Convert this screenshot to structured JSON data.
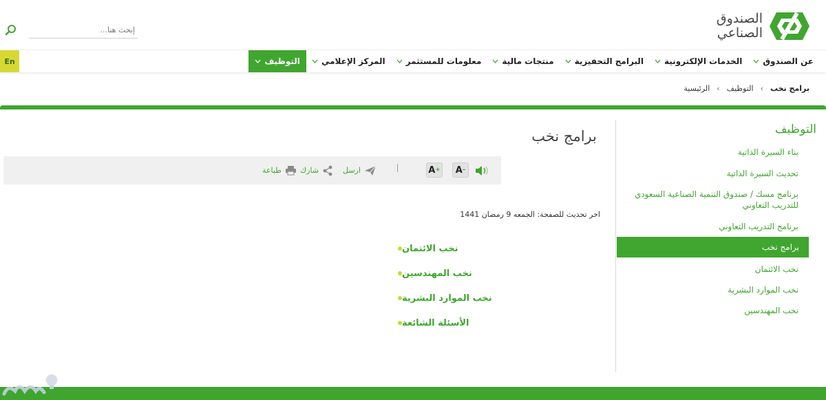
{
  "colors": {
    "brand_green": "#40a62f",
    "accent_yellow": "#d6d933"
  },
  "header": {
    "logo_line1": "الصندوق",
    "logo_line2": "الصناعي",
    "search_placeholder": "إبحث هنا..."
  },
  "nav": {
    "items": [
      {
        "label": "عن الصندوق",
        "dropdown": true
      },
      {
        "label": "الخدمات الإلكترونية",
        "dropdown": true
      },
      {
        "label": "البرامج التحفيزية",
        "dropdown": true
      },
      {
        "label": "منتجات مالية",
        "dropdown": true
      },
      {
        "label": "معلومات للمستثمر",
        "dropdown": true
      },
      {
        "label": "المركز الإعلامي",
        "dropdown": true
      },
      {
        "label": "التوظيف",
        "dropdown": true,
        "active": true
      }
    ],
    "lang_label": "En"
  },
  "breadcrumb": {
    "home": "الرئيسية",
    "parent": "التوظيف",
    "current": "برامج نخب"
  },
  "sidebar": {
    "title": "التوظيف",
    "items": [
      {
        "label": "بناء السيرة الذاتية"
      },
      {
        "label": "تحديث السيرة الذاتية"
      },
      {
        "label": "برنامج مسك / صندوق التنمية الصناعية السعودي للتدريب التعاوني"
      },
      {
        "label": "برنامج التدريب التعاوني"
      },
      {
        "label": "برامج نخب",
        "active": true
      },
      {
        "label": "نخب الائتمان"
      },
      {
        "label": "نخب الموارد البشرية"
      },
      {
        "label": "نخب المهندسين"
      }
    ]
  },
  "main": {
    "title": "برامج نخب",
    "toolbar": {
      "send": "ارسل",
      "share": "شارك",
      "print": "طباعة",
      "font_increase": "A",
      "font_decrease": "A"
    },
    "last_updated": "اخر تحديث للصفحة: الجمعه 9 رمضان 1441",
    "links": [
      "نخب الائتمان",
      "نخب المهندسين",
      "نخب الموارد البشرية",
      "الأسئلة الشائعة"
    ]
  }
}
